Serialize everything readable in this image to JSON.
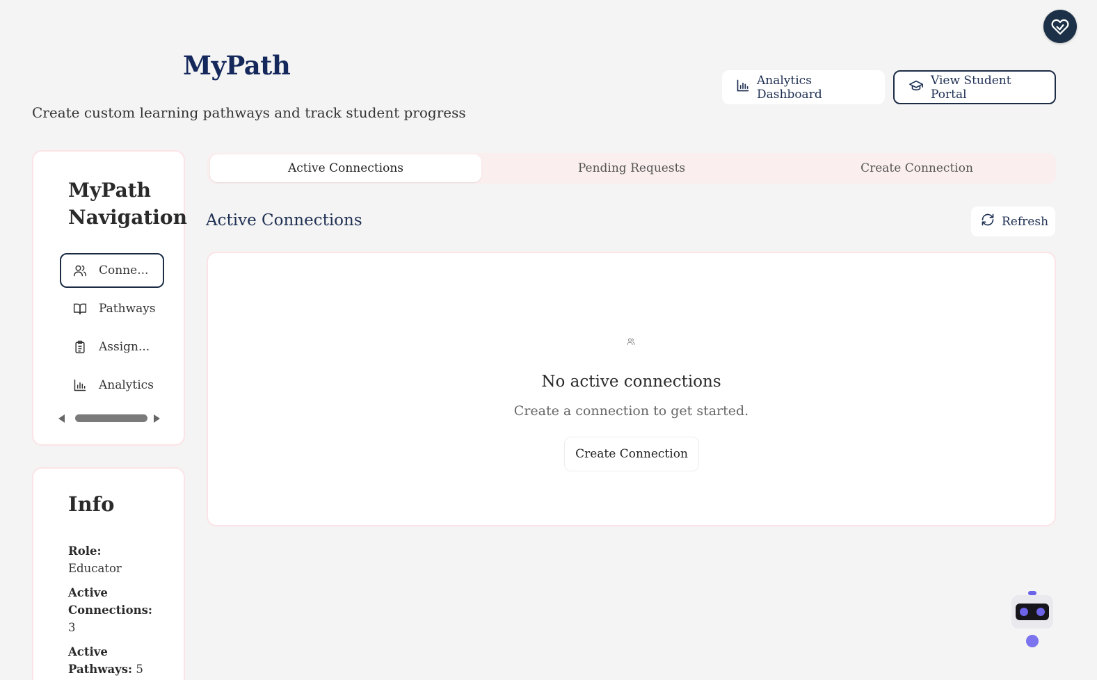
{
  "header": {
    "title": "MyPath",
    "subtitle": "Create custom learning pathways and track student progress",
    "analytics_label": "Analytics Dashboard",
    "portal_label": "View Student Portal"
  },
  "sidebar": {
    "title": "MyPath Navigation",
    "items": [
      {
        "label": "Conne...",
        "icon": "users-icon"
      },
      {
        "label": "Pathways",
        "icon": "book-icon"
      },
      {
        "label": "Assign...",
        "icon": "clipboard-icon"
      },
      {
        "label": "Analytics",
        "icon": "bar-chart-icon"
      }
    ]
  },
  "info": {
    "title": "Info",
    "role_label": "Role:",
    "role_value": "Educator",
    "connections_label": "Active Connections:",
    "connections_value": "3",
    "pathways_label": "Active Pathways:",
    "pathways_value": "5"
  },
  "tabs": [
    {
      "label": "Active Connections"
    },
    {
      "label": "Pending Requests"
    },
    {
      "label": "Create Connection"
    }
  ],
  "main": {
    "section_title": "Active Connections",
    "refresh_label": "Refresh",
    "empty_title": "No active connections",
    "empty_subtitle": "Create a connection to get started.",
    "empty_button": "Create Connection"
  },
  "colors": {
    "brand": "#14285c",
    "accent_border": "#fbe3e7",
    "dark_outline": "#1c2c44",
    "robot_accent": "#6c63e8"
  }
}
